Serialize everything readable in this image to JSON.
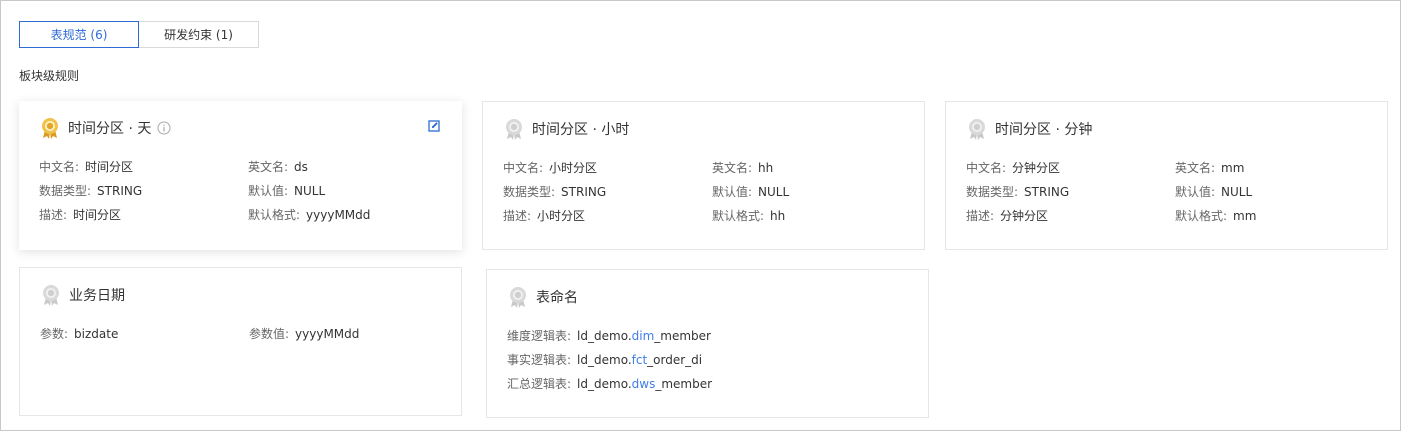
{
  "tabs": [
    {
      "label": "表规范 (6)",
      "active": true
    },
    {
      "label": "研发约束 (1)",
      "active": false
    }
  ],
  "section_title": "板块级规则",
  "cards": [
    {
      "title": "时间分区 · 天",
      "icon": "award-gold-icon",
      "fields": [
        {
          "k": "中文名:",
          "v": "时间分区"
        },
        {
          "k": "英文名:",
          "v": "ds"
        },
        {
          "k": "数据类型:",
          "v": "STRING"
        },
        {
          "k": "默认值:",
          "v": "NULL"
        },
        {
          "k": "描述:",
          "v": "时间分区"
        },
        {
          "k": "默认格式:",
          "v": "yyyyMMdd"
        }
      ]
    },
    {
      "title": "时间分区 · 小时",
      "icon": "award-gray-icon",
      "fields": [
        {
          "k": "中文名:",
          "v": "小时分区"
        },
        {
          "k": "英文名:",
          "v": "hh"
        },
        {
          "k": "数据类型:",
          "v": "STRING"
        },
        {
          "k": "默认值:",
          "v": "NULL"
        },
        {
          "k": "描述:",
          "v": "小时分区"
        },
        {
          "k": "默认格式:",
          "v": "hh"
        }
      ]
    },
    {
      "title": "时间分区 · 分钟",
      "icon": "award-gray-icon",
      "fields": [
        {
          "k": "中文名:",
          "v": "分钟分区"
        },
        {
          "k": "英文名:",
          "v": "mm"
        },
        {
          "k": "数据类型:",
          "v": "STRING"
        },
        {
          "k": "默认值:",
          "v": "NULL"
        },
        {
          "k": "描述:",
          "v": "分钟分区"
        },
        {
          "k": "默认格式:",
          "v": "mm"
        }
      ]
    },
    {
      "title": "业务日期",
      "icon": "award-gray-icon",
      "fields": [
        {
          "k": "参数:",
          "v": "bizdate"
        },
        {
          "k": "参数值:",
          "v": "yyyyMMdd"
        }
      ]
    },
    {
      "title": "表命名",
      "icon": "award-gray-icon",
      "fields": [
        {
          "k": "维度逻辑表:",
          "pre": "ld_demo.",
          "hl": "dim",
          "post": "_member"
        },
        {
          "k": "事实逻辑表:",
          "pre": "ld_demo.",
          "hl": "fct",
          "post": "_order_di"
        },
        {
          "k": "汇总逻辑表:",
          "pre": "ld_demo.",
          "hl": "dws",
          "post": "_member"
        }
      ]
    }
  ],
  "colors": {
    "accent": "#2e6bd4",
    "highlight": "#3e7ee8",
    "gold": "#e2b13c"
  }
}
